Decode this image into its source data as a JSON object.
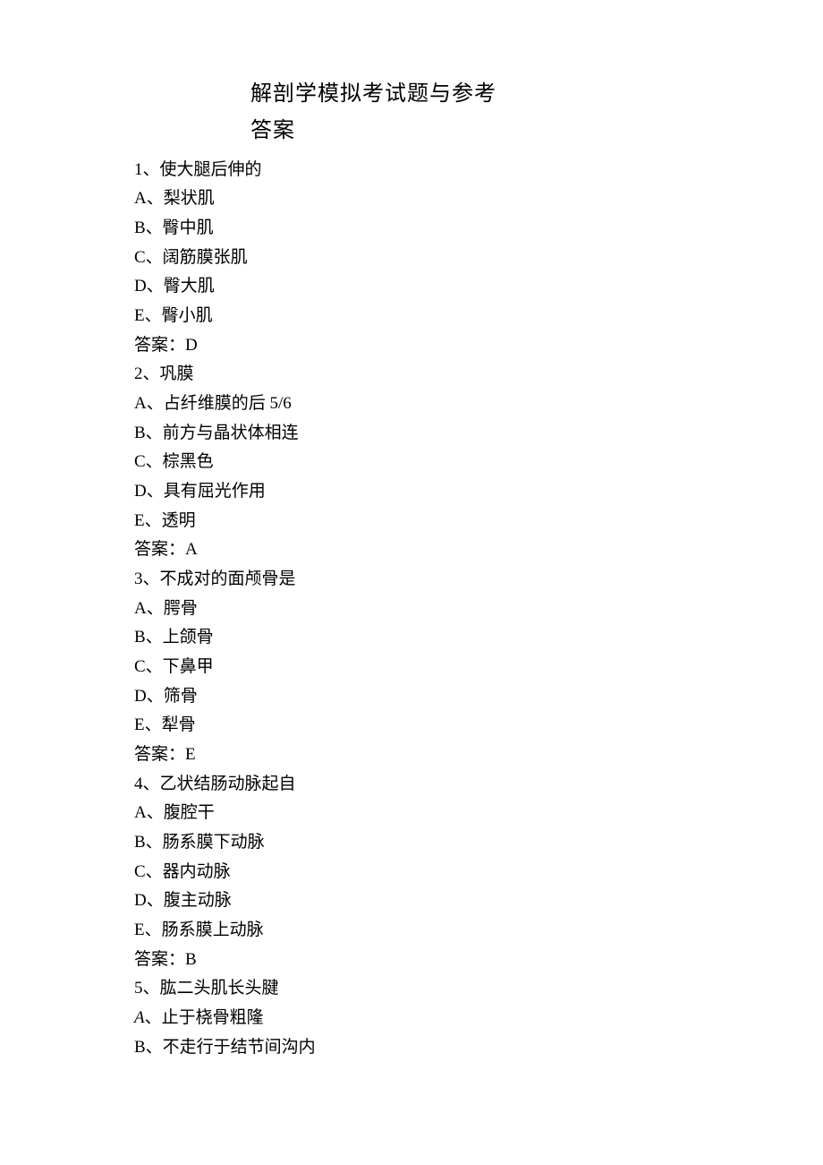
{
  "title": {
    "line1": "解剖学模拟考试题与参考",
    "line2": "答案"
  },
  "questions": [
    {
      "number": "1",
      "stem": "使大腿后伸的",
      "options": [
        {
          "label": "A",
          "text": "梨状肌"
        },
        {
          "label": "B",
          "text": "臀中肌"
        },
        {
          "label": "C",
          "text": "阔筋膜张肌"
        },
        {
          "label": "D",
          "text": "臀大肌"
        },
        {
          "label": "E",
          "text": "臀小肌"
        }
      ],
      "answer_label": "答案：",
      "answer": "D"
    },
    {
      "number": "2",
      "stem": "巩膜",
      "options": [
        {
          "label": "A",
          "text": "占纤维膜的后 5/6"
        },
        {
          "label": "B",
          "text": "前方与晶状体相连"
        },
        {
          "label": "C",
          "text": "棕黑色"
        },
        {
          "label": "D",
          "text": "具有屈光作用"
        },
        {
          "label": "E",
          "text": "透明"
        }
      ],
      "answer_label": "答案：",
      "answer": "A"
    },
    {
      "number": "3",
      "stem": "不成对的面颅骨是",
      "options": [
        {
          "label": "A",
          "text": "腭骨"
        },
        {
          "label": "B",
          "text": "上颌骨"
        },
        {
          "label": "C",
          "text": "下鼻甲"
        },
        {
          "label": "D",
          "text": "筛骨"
        },
        {
          "label": "E",
          "text": "犁骨"
        }
      ],
      "answer_label": "答案：",
      "answer": "E"
    },
    {
      "number": "4",
      "stem": "乙状结肠动脉起自",
      "options": [
        {
          "label": "A",
          "text": "腹腔干"
        },
        {
          "label": "B",
          "text": "肠系膜下动脉"
        },
        {
          "label": "C",
          "text": "器内动脉"
        },
        {
          "label": "D",
          "text": "腹主动脉"
        },
        {
          "label": "E",
          "text": "肠系膜上动脉"
        }
      ],
      "answer_label": "答案：",
      "answer": "B"
    },
    {
      "number": "5",
      "stem": "肱二头肌长头腱",
      "options": [
        {
          "label": "A",
          "text": "止于桡骨粗隆",
          "italic_label": true
        },
        {
          "label": "B",
          "text": "不走行于结节间沟内"
        }
      ]
    }
  ]
}
